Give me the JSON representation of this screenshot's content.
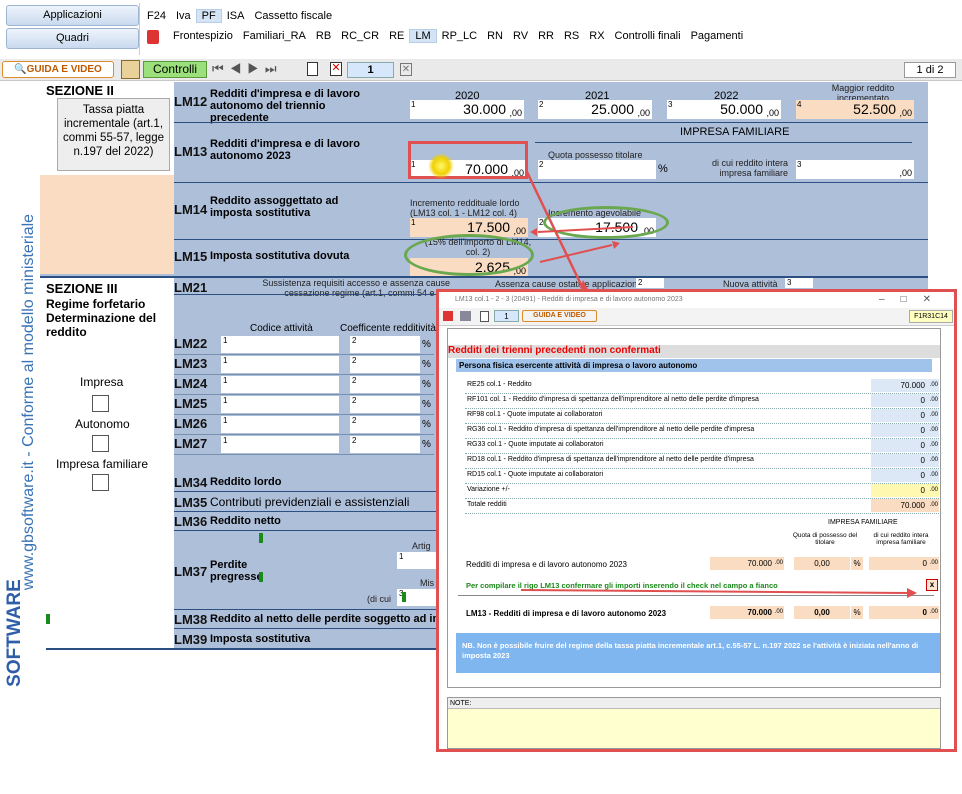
{
  "nav": {
    "applicazioni": "Applicazioni",
    "quadri": "Quadri"
  },
  "menu1": [
    "F24",
    "Iva",
    "PF",
    "ISA",
    "Cassetto fiscale"
  ],
  "menu1_selected": "PF",
  "menu2": [
    "Frontespizio",
    "Familiari_RA",
    "RB",
    "RC_CR",
    "RE",
    "LM",
    "RP_LC",
    "RN",
    "RV",
    "RR",
    "RS",
    "RX",
    "Controlli finali",
    "Pagamenti"
  ],
  "menu2_selected": "LM",
  "toolbar": {
    "guida": "GUIDA E VIDEO",
    "controlli": "Controlli",
    "page_input": "1",
    "page_of": "1 di 2"
  },
  "side": {
    "vertical": "www.gbsoftware.it - Conforme al modello ministeriale",
    "brand": "SOFTWARE"
  },
  "sez2": {
    "title": "SEZIONE II",
    "box": "Tassa piatta incrementale (art.1, commi 55-57, legge n.197 del 2022)",
    "lm12": {
      "code": "LM12",
      "label": "Redditi d'impresa e di lavoro autonomo del triennio precedente",
      "y1": "2020",
      "y2": "2021",
      "y3": "2022",
      "y4": "Maggior reddito incrementato",
      "v1": "30.000",
      "v2": "25.000",
      "v3": "50.000",
      "v4": "52.500",
      "n1": "1",
      "n2": "2",
      "n3": "3",
      "n4": "4"
    },
    "lm13": {
      "code": "LM13",
      "label": "Redditi d'impresa e di lavoro autonomo 2023",
      "impresa": "IMPRESA FAMILIARE",
      "quota": "Quota possesso titolare",
      "dicui": "di cui reddito intera impresa familiare",
      "v1": "70.000",
      "pct": "%",
      "n1": "1",
      "n2": "2",
      "n3": "3"
    },
    "lm14": {
      "code": "LM14",
      "label": "Reddito assoggettato ad imposta sostitutiva",
      "inc": "Incremento reddituale lordo (LM13 col. 1 - LM12 col. 4)",
      "agev": "Incremento agevolabile",
      "v1": "17.500",
      "v2": "17.500",
      "n1": "1",
      "n2": "2"
    },
    "lm15": {
      "code": "LM15",
      "label": "Imposta sostitutiva dovuta",
      "note": "(15% dell'importo di LM14, col. 2)",
      "v1": "2.625"
    }
  },
  "sez3": {
    "title": "SEZIONE III",
    "sub": "Regime forfetario Determinazione del reddito",
    "lm21": {
      "code": "LM21",
      "t1": "Sussistenza requisiti accesso e assenza cause cessazione regime (art.1, commi 54 e 71)",
      "t2": "Assenza cause ostative applicazione",
      "t3": "Nuova attività",
      "n1": "1",
      "n2": "2",
      "n3": "3"
    },
    "cod": "Codice attività",
    "coeff": "Coefficente redditività",
    "rows": [
      "LM22",
      "LM23",
      "LM24",
      "LM25",
      "LM26",
      "LM27"
    ],
    "impresa": "Impresa",
    "autonomo": "Autonomo",
    "familiare": "Impresa familiare",
    "lm34": {
      "code": "LM34",
      "label": "Reddito lordo"
    },
    "lm35": {
      "code": "LM35",
      "label": "Contributi previdenziali e assistenziali"
    },
    "lm36": {
      "code": "LM36",
      "label": "Reddito netto"
    },
    "lm37": {
      "code": "LM37",
      "label": "Perdite pregresse",
      "artig": "Artig",
      "mis": "Mis",
      "dicui": "(di cui"
    },
    "lm38": {
      "code": "LM38",
      "label": "Reddito al netto delle perdite soggetto ad imp"
    },
    "lm39": {
      "code": "LM39",
      "label": "Imposta sostitutiva"
    }
  },
  "dialog": {
    "title": "LM13 col.1 - 2 - 3 (20491) - Redditi di impresa e di lavoro autonomo 2023",
    "guida": "GUIDA E VIDEO",
    "page": "1",
    "code": "F1R31C14",
    "heading": "Redditi dei trienni precedenti non confermati",
    "subhead": "Persona fisica esercente attività di impresa o lavoro autonomo",
    "rows": [
      {
        "t": "RE25 col.1 - Reddito",
        "v": "70.000"
      },
      {
        "t": "RF101 col. 1 - Reddito d'impresa di spettanza dell'imprenditore al netto delle perdite d'impresa",
        "v": "0"
      },
      {
        "t": "RF98  col.1 - Quote imputate ai collaboratori",
        "v": "0"
      },
      {
        "t": "RG36 col.1 - Reddito d'impresa di spettanza dell'imprenditore al netto delle perdite d'impresa",
        "v": "0"
      },
      {
        "t": "RG33  col.1 - Quote imputate ai collaboratori",
        "v": "0"
      },
      {
        "t": "RD18  col.1 - Reddito d'impresa di spettanza dell'imprenditore al netto delle perdite d'impresa",
        "v": "0"
      },
      {
        "t": "RD15  col.1 - Quote imputate ai collaboratori",
        "v": "0"
      },
      {
        "t": "Variazione +/-",
        "v": "0"
      },
      {
        "t": "Totale redditi",
        "v": "70.000"
      }
    ],
    "dec": ".00",
    "impresa": "IMPRESA FAMILIARE",
    "quota": "Quota di possesso del titolare",
    "dicui": "di cui reddito intera impresa familiare",
    "redditi": "Redditi di impresa e di lavoro autonomo 2023",
    "r_v1": "70.000",
    "r_v2": "0,00",
    "r_v3": "0",
    "pct": "%",
    "confirm": "Per compilare il rigo LM13 confermare gli importi inserendo il check nel campo a fianco",
    "check": "x",
    "lm13": "LM13 - Redditi di impresa e di lavoro autonomo 2023",
    "l_v1": "70.000",
    "l_v2": "0,00",
    "l_v3": "0",
    "nb": "NB. Non è possibile fruire del regime della tassa piatta incrementale art.1, c.55-57 L. n.197 2022 se l'attività è iniziata nell'anno di imposta 2023",
    "note": "NOTE:"
  },
  "colors": {
    "form_bg": "#aebfd9",
    "peach": "#f9dcc1",
    "red": "#e05050",
    "green": "#6aa84f",
    "nb_bg": "#7fb6f0"
  }
}
